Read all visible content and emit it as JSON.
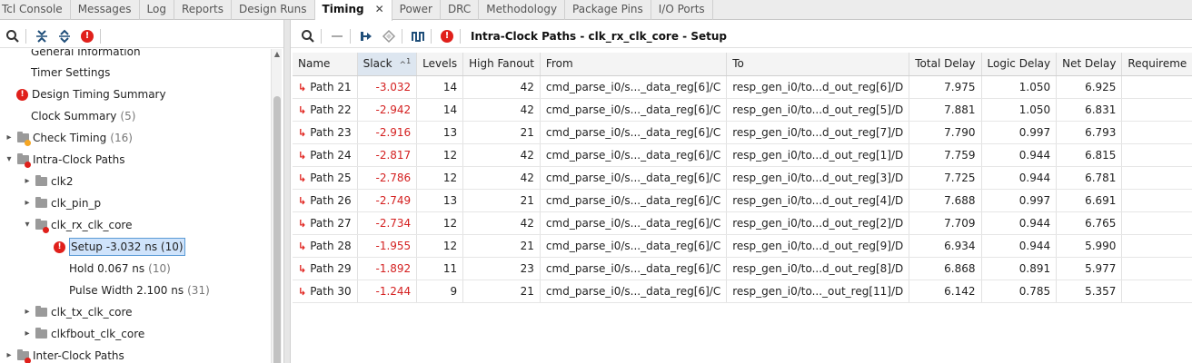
{
  "tabs": [
    {
      "label": "Tcl Console"
    },
    {
      "label": "Messages"
    },
    {
      "label": "Log"
    },
    {
      "label": "Reports"
    },
    {
      "label": "Design Runs"
    },
    {
      "label": "Timing",
      "active": true
    },
    {
      "label": "Power"
    },
    {
      "label": "DRC"
    },
    {
      "label": "Methodology"
    },
    {
      "label": "Package Pins"
    },
    {
      "label": "I/O Ports"
    }
  ],
  "active_tab_close": "✕",
  "left_toolbar": {
    "icons": [
      "search-icon",
      "collapse-all-icon",
      "expand-all-icon",
      "error-filter-icon"
    ]
  },
  "tree": {
    "general_information": "General Information",
    "timer_settings": "Timer Settings",
    "design_timing_summary": "Design Timing Summary",
    "clock_summary": "Clock Summary",
    "clock_summary_count": "(5)",
    "check_timing": "Check Timing",
    "check_timing_count": "(16)",
    "intra_clock_paths": "Intra-Clock Paths",
    "clk2": "clk2",
    "clk_pin_p": "clk_pin_p",
    "clk_rx_clk_core": "clk_rx_clk_core",
    "setup": "Setup -3.032 ns (10)",
    "hold": "Hold 0.067 ns",
    "hold_count": "(10)",
    "pulse_width": "Pulse Width 2.100 ns",
    "pulse_width_count": "(31)",
    "clk_tx_clk_core": "clk_tx_clk_core",
    "clkfbout_clk_core": "clkfbout_clk_core",
    "inter_clock_paths": "Inter-Clock Paths"
  },
  "right_toolbar": {
    "title": "Intra-Clock Paths - clk_rx_clk_core - Setup"
  },
  "table": {
    "columns": [
      "Name",
      "Slack",
      "Levels",
      "High Fanout",
      "From",
      "To",
      "Total Delay",
      "Logic Delay",
      "Net Delay",
      "Requireme"
    ],
    "sort_indicator": "^",
    "sort_rank": "1",
    "rows": [
      {
        "name": "Path 21",
        "slack": "-3.032",
        "levels": "14",
        "fanout": "42",
        "from": "cmd_parse_i0/s..._data_reg[6]/C",
        "to": "resp_gen_i0/to...d_out_reg[6]/D",
        "total": "7.975",
        "logic": "1.050",
        "net": "6.925"
      },
      {
        "name": "Path 22",
        "slack": "-2.942",
        "levels": "14",
        "fanout": "42",
        "from": "cmd_parse_i0/s..._data_reg[6]/C",
        "to": "resp_gen_i0/to...d_out_reg[5]/D",
        "total": "7.881",
        "logic": "1.050",
        "net": "6.831"
      },
      {
        "name": "Path 23",
        "slack": "-2.916",
        "levels": "13",
        "fanout": "21",
        "from": "cmd_parse_i0/s..._data_reg[6]/C",
        "to": "resp_gen_i0/to...d_out_reg[7]/D",
        "total": "7.790",
        "logic": "0.997",
        "net": "6.793"
      },
      {
        "name": "Path 24",
        "slack": "-2.817",
        "levels": "12",
        "fanout": "42",
        "from": "cmd_parse_i0/s..._data_reg[6]/C",
        "to": "resp_gen_i0/to...d_out_reg[1]/D",
        "total": "7.759",
        "logic": "0.944",
        "net": "6.815"
      },
      {
        "name": "Path 25",
        "slack": "-2.786",
        "levels": "12",
        "fanout": "42",
        "from": "cmd_parse_i0/s..._data_reg[6]/C",
        "to": "resp_gen_i0/to...d_out_reg[3]/D",
        "total": "7.725",
        "logic": "0.944",
        "net": "6.781"
      },
      {
        "name": "Path 26",
        "slack": "-2.749",
        "levels": "13",
        "fanout": "21",
        "from": "cmd_parse_i0/s..._data_reg[6]/C",
        "to": "resp_gen_i0/to...d_out_reg[4]/D",
        "total": "7.688",
        "logic": "0.997",
        "net": "6.691"
      },
      {
        "name": "Path 27",
        "slack": "-2.734",
        "levels": "12",
        "fanout": "42",
        "from": "cmd_parse_i0/s..._data_reg[6]/C",
        "to": "resp_gen_i0/to...d_out_reg[2]/D",
        "total": "7.709",
        "logic": "0.944",
        "net": "6.765"
      },
      {
        "name": "Path 28",
        "slack": "-1.955",
        "levels": "12",
        "fanout": "21",
        "from": "cmd_parse_i0/s..._data_reg[6]/C",
        "to": "resp_gen_i0/to...d_out_reg[9]/D",
        "total": "6.934",
        "logic": "0.944",
        "net": "5.990"
      },
      {
        "name": "Path 29",
        "slack": "-1.892",
        "levels": "11",
        "fanout": "23",
        "from": "cmd_parse_i0/s..._data_reg[6]/C",
        "to": "resp_gen_i0/to...d_out_reg[8]/D",
        "total": "6.868",
        "logic": "0.891",
        "net": "5.977"
      },
      {
        "name": "Path 30",
        "slack": "-1.244",
        "levels": "9",
        "fanout": "21",
        "from": "cmd_parse_i0/s..._data_reg[6]/C",
        "to": "resp_gen_i0/to..._out_reg[11]/D",
        "total": "6.142",
        "logic": "0.785",
        "net": "5.357"
      }
    ]
  },
  "colors": {
    "slack_negative": "#d42020",
    "error_red": "#e0201b",
    "selection": "#cfe3fb"
  }
}
